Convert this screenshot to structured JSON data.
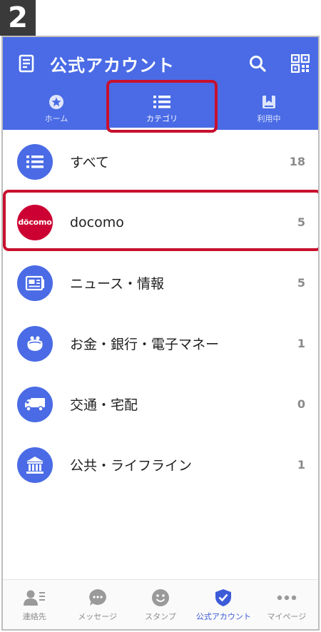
{
  "step": "2",
  "header": {
    "title": "公式アカウント",
    "tabs": [
      {
        "label": "ホーム",
        "icon": "star-circle-icon"
      },
      {
        "label": "カテゴリ",
        "icon": "list-icon",
        "active": true
      },
      {
        "label": "利用中",
        "icon": "bookmark-icon"
      }
    ]
  },
  "categories": [
    {
      "name": "すべて",
      "count": "18",
      "icon": "list-icon"
    },
    {
      "name": "docomo",
      "count": "5",
      "icon": "docomo-logo",
      "logo_text": "döcomo"
    },
    {
      "name": "ニュース・情報",
      "count": "5",
      "icon": "newspaper-icon"
    },
    {
      "name": "お金・銀行・電子マネー",
      "count": "1",
      "icon": "purse-icon"
    },
    {
      "name": "交通・宅配",
      "count": "0",
      "icon": "truck-icon"
    },
    {
      "name": "公共・ライフライン",
      "count": "1",
      "icon": "public-building-icon"
    }
  ],
  "bottom_nav": [
    {
      "label": "連絡先",
      "icon": "contacts-icon"
    },
    {
      "label": "メッセージ",
      "icon": "message-icon"
    },
    {
      "label": "スタンプ",
      "icon": "smiley-icon"
    },
    {
      "label": "公式アカウント",
      "icon": "shield-check-icon",
      "active": true
    },
    {
      "label": "マイページ",
      "icon": "more-dots-icon"
    }
  ],
  "colors": {
    "accent": "#4a6be5",
    "highlight": "#c8102e",
    "docomo": "#cc0033"
  }
}
